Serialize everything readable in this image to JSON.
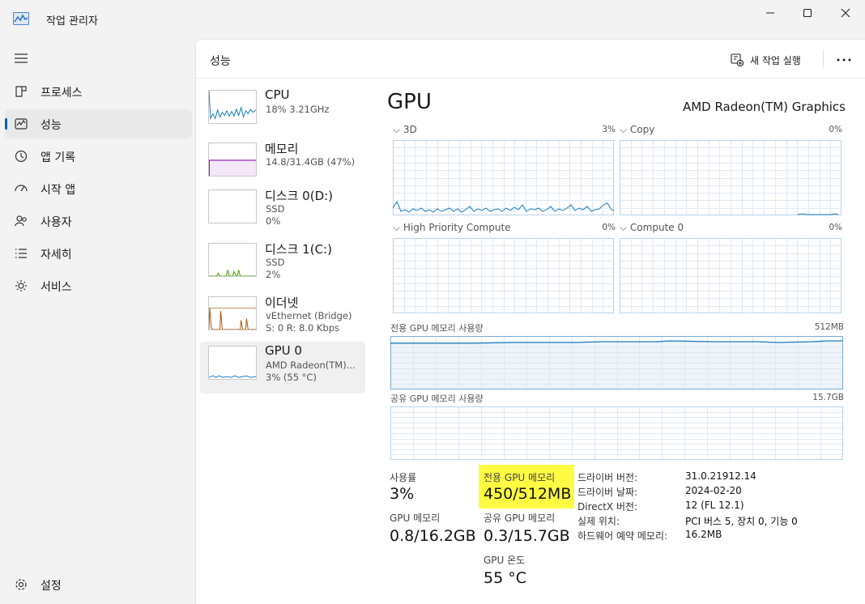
{
  "window": {
    "title": "작업 관리자"
  },
  "nav": {
    "items": [
      {
        "label": "프로세스",
        "icon": "processes-icon"
      },
      {
        "label": "성능",
        "icon": "performance-icon",
        "active": true
      },
      {
        "label": "앱 기록",
        "icon": "app-history-icon"
      },
      {
        "label": "시작 앱",
        "icon": "startup-apps-icon"
      },
      {
        "label": "사용자",
        "icon": "users-icon"
      },
      {
        "label": "자세히",
        "icon": "details-icon"
      },
      {
        "label": "서비스",
        "icon": "services-icon"
      }
    ],
    "settings": "설정"
  },
  "header": {
    "title": "성능",
    "new_task": "새 작업 실행"
  },
  "resources": [
    {
      "name": "CPU",
      "line1": "18% 3.21GHz",
      "line2": ""
    },
    {
      "name": "메모리",
      "line1": "14.8/31.4GB (47%)",
      "line2": ""
    },
    {
      "name": "디스크 0(D:)",
      "line1": "SSD",
      "line2": "0%"
    },
    {
      "name": "디스크 1(C:)",
      "line1": "SSD",
      "line2": "2%"
    },
    {
      "name": "이더넷",
      "line1": "vEthernet (Bridge)",
      "line2": "S: 0 R: 8.0 Kbps"
    },
    {
      "name": "GPU 0",
      "line1": "AMD Radeon(TM)...",
      "line2": "3% (55 °C)"
    }
  ],
  "gpu": {
    "title": "GPU",
    "model": "AMD Radeon(TM) Graphics",
    "engines": [
      {
        "label": "3D",
        "pct": "3%"
      },
      {
        "label": "Copy",
        "pct": "0%"
      },
      {
        "label": "High Priority Compute",
        "pct": "0%"
      },
      {
        "label": "Compute 0",
        "pct": "0%"
      }
    ],
    "dedicated_label": "전용 GPU 메모리 사용량",
    "dedicated_max": "512MB",
    "shared_label": "공유 GPU 메모리 사용량",
    "shared_max": "15.7GB",
    "stats": {
      "utilization_label": "사용률",
      "utilization": "3%",
      "gpu_mem_label": "GPU 메모리",
      "gpu_mem": "0.8/16.2GB",
      "dedicated_mem_label": "전용 GPU 메모리",
      "dedicated_mem": "450/512MB",
      "shared_mem_label": "공유 GPU 메모리",
      "shared_mem": "0.3/15.7GB",
      "temp_label": "GPU 온도",
      "temp": "55 °C"
    },
    "info": [
      {
        "k": "드라이버 버전:",
        "v": "31.0.21912.14"
      },
      {
        "k": "드라이버 날짜:",
        "v": "2024-02-20"
      },
      {
        "k": "DirectX 버전:",
        "v": "12 (FL 12.1)"
      },
      {
        "k": "실제 위치:",
        "v": "PCI 버스 5, 장치 0, 기능 0"
      },
      {
        "k": "하드웨어 예약 메모리:",
        "v": "16.2MB"
      }
    ]
  },
  "colors": {
    "cpu": "#117dbb",
    "memory": "#8b12ae",
    "disk": "#4da60c",
    "ethernet": "#a74f01",
    "gpu": "#1a7cc3",
    "highlight": "#fffb43"
  }
}
